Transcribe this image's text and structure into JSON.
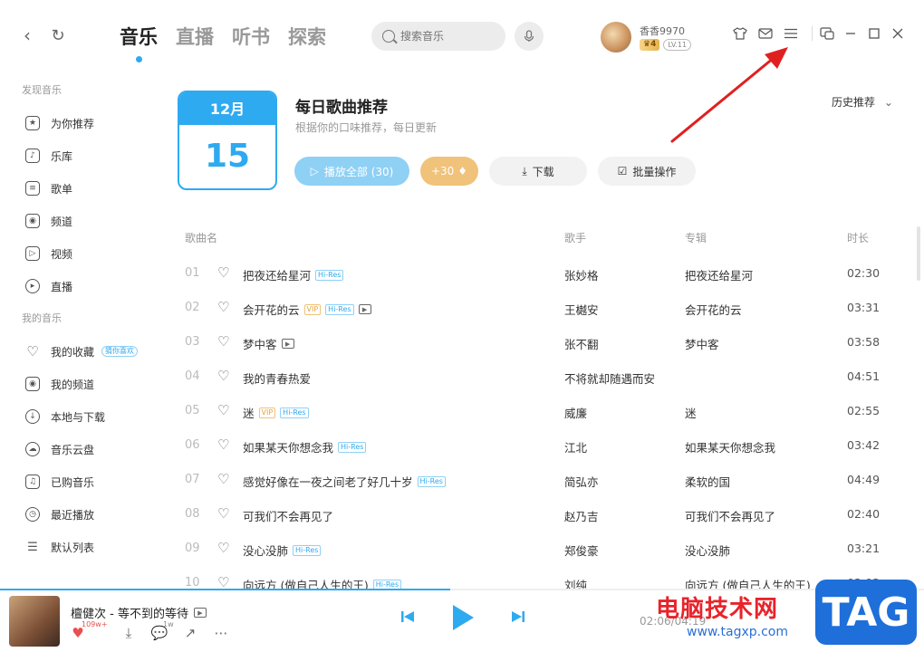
{
  "nav": {
    "back_icon": "‹",
    "refresh_icon": "↻"
  },
  "tabs": [
    {
      "label": "音乐",
      "active": true
    },
    {
      "label": "直播",
      "active": false
    },
    {
      "label": "听书",
      "active": false
    },
    {
      "label": "探索",
      "active": false
    }
  ],
  "search": {
    "placeholder": "搜索音乐"
  },
  "user": {
    "name": "香香9970",
    "vip_level": "4",
    "level": "LV.11"
  },
  "sidebar": {
    "section_discover": "发现音乐",
    "discover_items": [
      {
        "label": "为你推荐",
        "icon": "star-icon"
      },
      {
        "label": "乐库",
        "icon": "music-note-icon"
      },
      {
        "label": "歌单",
        "icon": "playlist-icon"
      },
      {
        "label": "频道",
        "icon": "radio-icon"
      },
      {
        "label": "视频",
        "icon": "video-icon"
      },
      {
        "label": "直播",
        "icon": "live-icon"
      }
    ],
    "section_mine": "我的音乐",
    "mine_items": [
      {
        "label": "我的收藏",
        "icon": "heart-icon",
        "tag": "猜你喜欢"
      },
      {
        "label": "我的频道",
        "icon": "radio-icon"
      },
      {
        "label": "本地与下载",
        "icon": "download-icon"
      },
      {
        "label": "音乐云盘",
        "icon": "cloud-icon"
      },
      {
        "label": "已购音乐",
        "icon": "bag-icon"
      },
      {
        "label": "最近播放",
        "icon": "clock-icon"
      },
      {
        "label": "默认列表",
        "icon": "list-icon"
      }
    ]
  },
  "daily": {
    "month": "12月",
    "day": "15",
    "title": "每日歌曲推荐",
    "subtitle": "根据你的口味推荐，每日更新",
    "history_label": "历史推荐",
    "play_all": "播放全部 (30)",
    "plus": "+30",
    "download": "下载",
    "batch": "批量操作"
  },
  "table": {
    "headers": {
      "name": "歌曲名",
      "singer": "歌手",
      "album": "专辑",
      "duration": "时长"
    },
    "rows": [
      {
        "num": "01",
        "title": "把夜还给星河",
        "tags": [
          "Hi-Res"
        ],
        "singer": "张妙格",
        "album": "把夜还给星河",
        "duration": "02:30"
      },
      {
        "num": "02",
        "title": "会开花的云",
        "tags": [
          "VIP",
          "Hi-Res",
          "MV"
        ],
        "singer": "王樾安",
        "album": "会开花的云",
        "duration": "03:31"
      },
      {
        "num": "03",
        "title": "梦中客",
        "tags": [
          "MV"
        ],
        "singer": "张不翻",
        "album": "梦中客",
        "duration": "03:58"
      },
      {
        "num": "04",
        "title": "我的青春热爱",
        "tags": [],
        "singer": "不将就却随遇而安",
        "album": "",
        "duration": "04:51"
      },
      {
        "num": "05",
        "title": "迷",
        "tags": [
          "VIP",
          "Hi-Res"
        ],
        "singer": "威廉",
        "album": "迷",
        "duration": "02:55"
      },
      {
        "num": "06",
        "title": "如果某天你想念我",
        "tags": [
          "Hi-Res"
        ],
        "singer": "江北",
        "album": "如果某天你想念我",
        "duration": "03:42"
      },
      {
        "num": "07",
        "title": "感觉好像在一夜之间老了好几十岁",
        "tags": [
          "Hi-Res"
        ],
        "singer": "简弘亦",
        "album": "柔软的国",
        "duration": "04:49"
      },
      {
        "num": "08",
        "title": "可我们不会再见了",
        "tags": [],
        "singer": "赵乃吉",
        "album": "可我们不会再见了",
        "duration": "02:40"
      },
      {
        "num": "09",
        "title": "没心没肺",
        "tags": [
          "Hi-Res"
        ],
        "singer": "郑俊豪",
        "album": "没心没肺",
        "duration": "03:21"
      },
      {
        "num": "10",
        "title": "向远方 (做自己人生的王)",
        "tags": [
          "Hi-Res"
        ],
        "singer": "刘纯",
        "album": "向远方 (做自己人生的王)",
        "duration": "03:03"
      }
    ]
  },
  "player": {
    "song": "檀健次 - 等不到的等待",
    "like_count": "109w+",
    "comment_count": "1w",
    "current_time": "02:06",
    "total_time": "04:19",
    "time_display": "02:06/04:19",
    "progress": 0.487
  },
  "watermark": {
    "text": "电脑技术网",
    "url": "www.tagxp.com",
    "tag": "TAG"
  },
  "colors": {
    "accent": "#2eaaf0",
    "vip": "#f0c27a",
    "arrow": "#e02020"
  }
}
